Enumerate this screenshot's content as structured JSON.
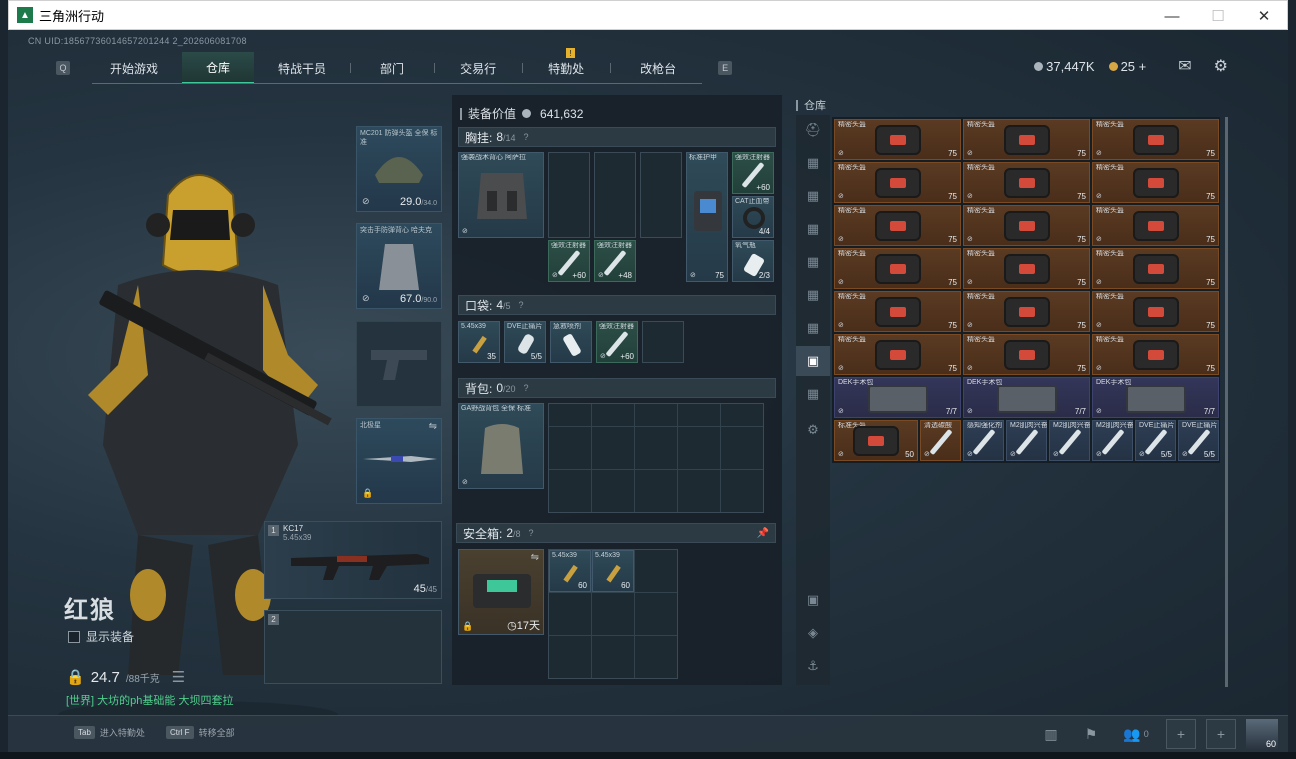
{
  "window": {
    "title": "三角洲行动",
    "min": "—",
    "max": "☐",
    "close": "✕"
  },
  "uid": "CN UID:18567736014657201244 2_202606081708",
  "nav": {
    "key_left": "Q",
    "key_right": "E",
    "tabs": [
      "开始游戏",
      "仓库",
      "特战干员",
      "部门",
      "交易行",
      "特勤处",
      "改枪台"
    ],
    "active": "仓库",
    "badge": "!"
  },
  "topbar": {
    "currency1": "37,447K",
    "currency2": "25 +"
  },
  "character": {
    "name": "红狼",
    "show_equip": "显示装备",
    "weight": "24.7",
    "weight_max": "/88千克",
    "chat": "[世界] 大坊的ph基础能 大坝四套拉"
  },
  "gear": {
    "helmet": {
      "label": "MC201 防弹头盔 全保 标准",
      "value": "29.0",
      "max": "/34.0"
    },
    "armor": {
      "label": "突击手防弹背心 哈夫克",
      "value": "67.0",
      "max": "/90.0"
    },
    "melee": {
      "label": "北极星"
    },
    "weapon1": {
      "num": "1",
      "name": "KC17",
      "ammo": "5.45x39",
      "count": "45",
      "max": "/45"
    },
    "weapon2": {
      "num": "2"
    }
  },
  "center": {
    "equip_value_label": "装备价值",
    "equip_value": "641,632",
    "chest": {
      "title": "胸挂:",
      "count": "8",
      "max": "/14",
      "q": "?"
    },
    "pocket": {
      "title": "口袋:",
      "count": "4",
      "max": "/5",
      "q": "?"
    },
    "backpack": {
      "title": "背包:",
      "count": "0",
      "max": "/20",
      "q": "?"
    },
    "safe": {
      "title": "安全箱:",
      "count": "2",
      "max": "/8",
      "q": "?",
      "timer": "17天"
    },
    "chest_rig": {
      "label": "强袭战术背心 阿萨拉"
    },
    "chest_items": [
      {
        "label": "标准护甲",
        "v": "75"
      },
      {
        "label": "强效注射器",
        "v": "+60"
      },
      {
        "label": "CAT止血带",
        "v": "4/4"
      },
      {
        "label": "氧气瓶",
        "v": "2/3"
      },
      {
        "label": "强效注射器",
        "v": "+60"
      },
      {
        "label": "强效注射器",
        "v": "+48"
      }
    ],
    "pocket_items": [
      {
        "label": "5.45x39",
        "v": "35"
      },
      {
        "label": "DVE止痛片",
        "v": "5/5"
      },
      {
        "label": "急救喷剂",
        "v": ""
      },
      {
        "label": "强效注射器",
        "v": "+60"
      }
    ],
    "backpack_item": {
      "label": "GA野战背包 全保 标准"
    },
    "safe_items": [
      {
        "label": "5.45x39",
        "v": "60"
      },
      {
        "label": "5.45x39",
        "v": "60"
      }
    ]
  },
  "warehouse": {
    "title": "仓库",
    "helmet_label": "精密头盔",
    "helmet_v": "75",
    "case_label": "DEK手术包",
    "case_v": "7/7",
    "last_row": [
      {
        "label": "标准头盔",
        "v": "50"
      },
      {
        "label": "清透碳酸",
        "v": ""
      },
      {
        "label": "感知强化剂",
        "v": ""
      },
      {
        "label": "M2肌肉兴奋剂",
        "v": ""
      },
      {
        "label": "M2肌肉兴奋剂",
        "v": ""
      },
      {
        "label": "M2肌肉兴奋剂",
        "v": ""
      },
      {
        "label": "DVE止痛片",
        "v": "5/5"
      },
      {
        "label": "DVE止痛片",
        "v": "5/5"
      }
    ]
  },
  "bottom": {
    "hint1_key": "Tab",
    "hint1": "进入特勤处",
    "hint2_key": "Ctrl F",
    "hint2": "转移全部",
    "friends": "0",
    "avatar_level": "60"
  }
}
